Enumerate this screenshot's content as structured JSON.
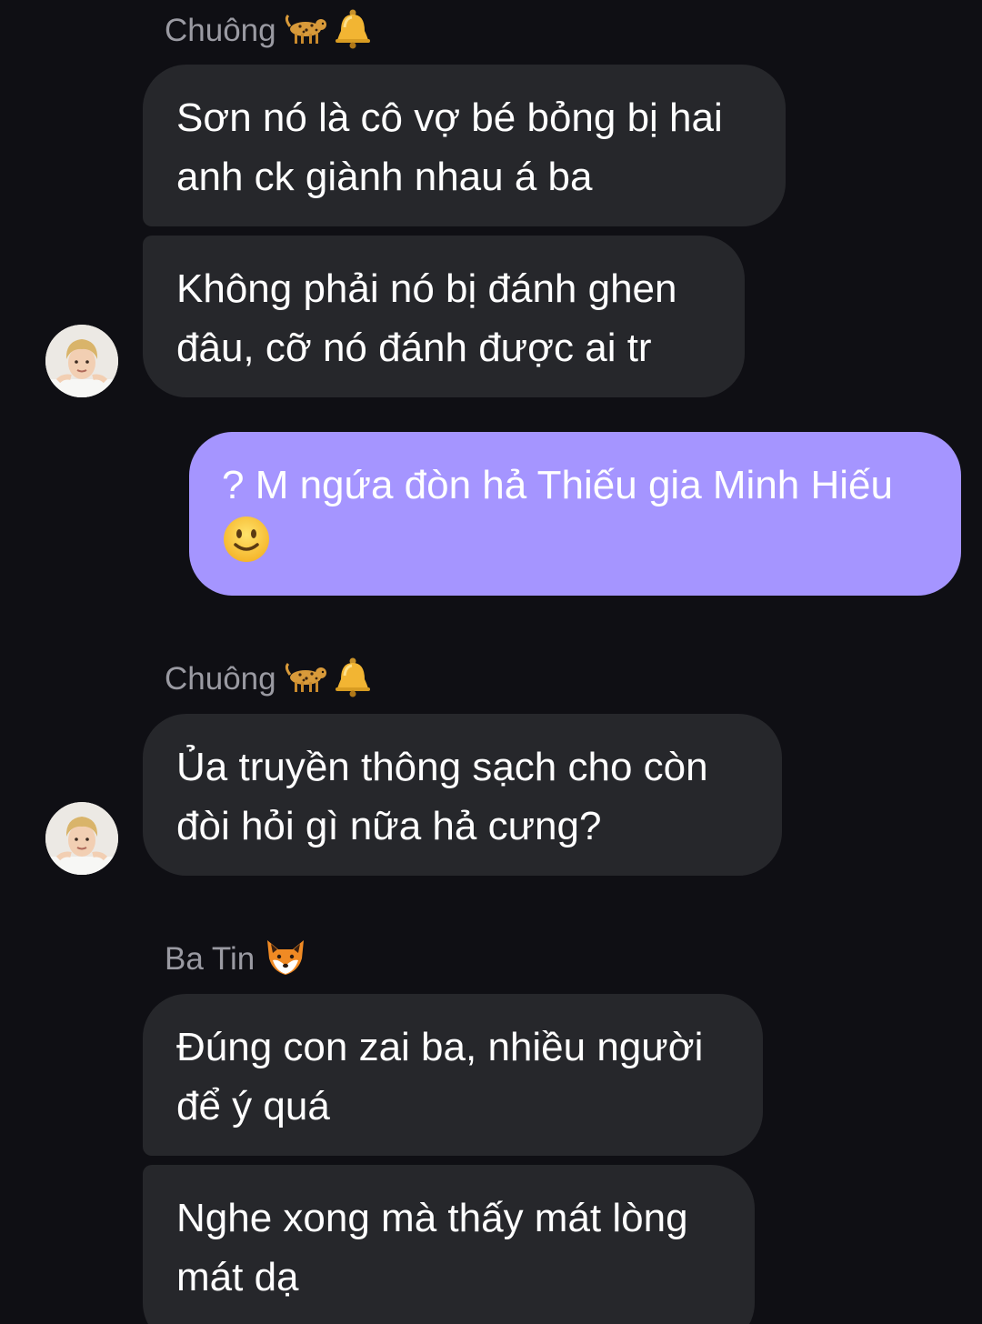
{
  "messages": [
    {
      "sender": "Chuông",
      "sender_icons": [
        "cheetah-icon",
        "bell-icon"
      ],
      "bubbles": [
        "Sơn nó là cô vợ bé bỏng bị hai anh ck giành nhau á ba",
        "Không phải nó bị đánh ghen đâu, cỡ nó đánh được ai tr"
      ]
    },
    {
      "sender": "",
      "own": true,
      "bubbles": [
        "? M ngứa đòn hả Thiếu gia Minh Hiếu"
      ],
      "bubble_icons": [
        "slightly-smiling-face-icon"
      ]
    },
    {
      "sender": "Chuông",
      "sender_icons": [
        "cheetah-icon",
        "bell-icon"
      ],
      "bubbles": [
        "Ủa truyền thông sạch cho còn đòi hỏi gì nữa hả cưng?"
      ]
    },
    {
      "sender": "Ba Tin",
      "sender_icons": [
        "fox-face-icon"
      ],
      "bubbles": [
        "Đúng con zai ba, nhiều người để ý quá",
        "Nghe xong mà thấy mát lòng mát dạ"
      ]
    }
  ],
  "colors": {
    "background": "#0f0f14",
    "incoming_bubble": "#26272b",
    "outgoing_bubble": "#a595ff",
    "sender_name": "#9a9aa2",
    "message_text": "#ffffff"
  }
}
